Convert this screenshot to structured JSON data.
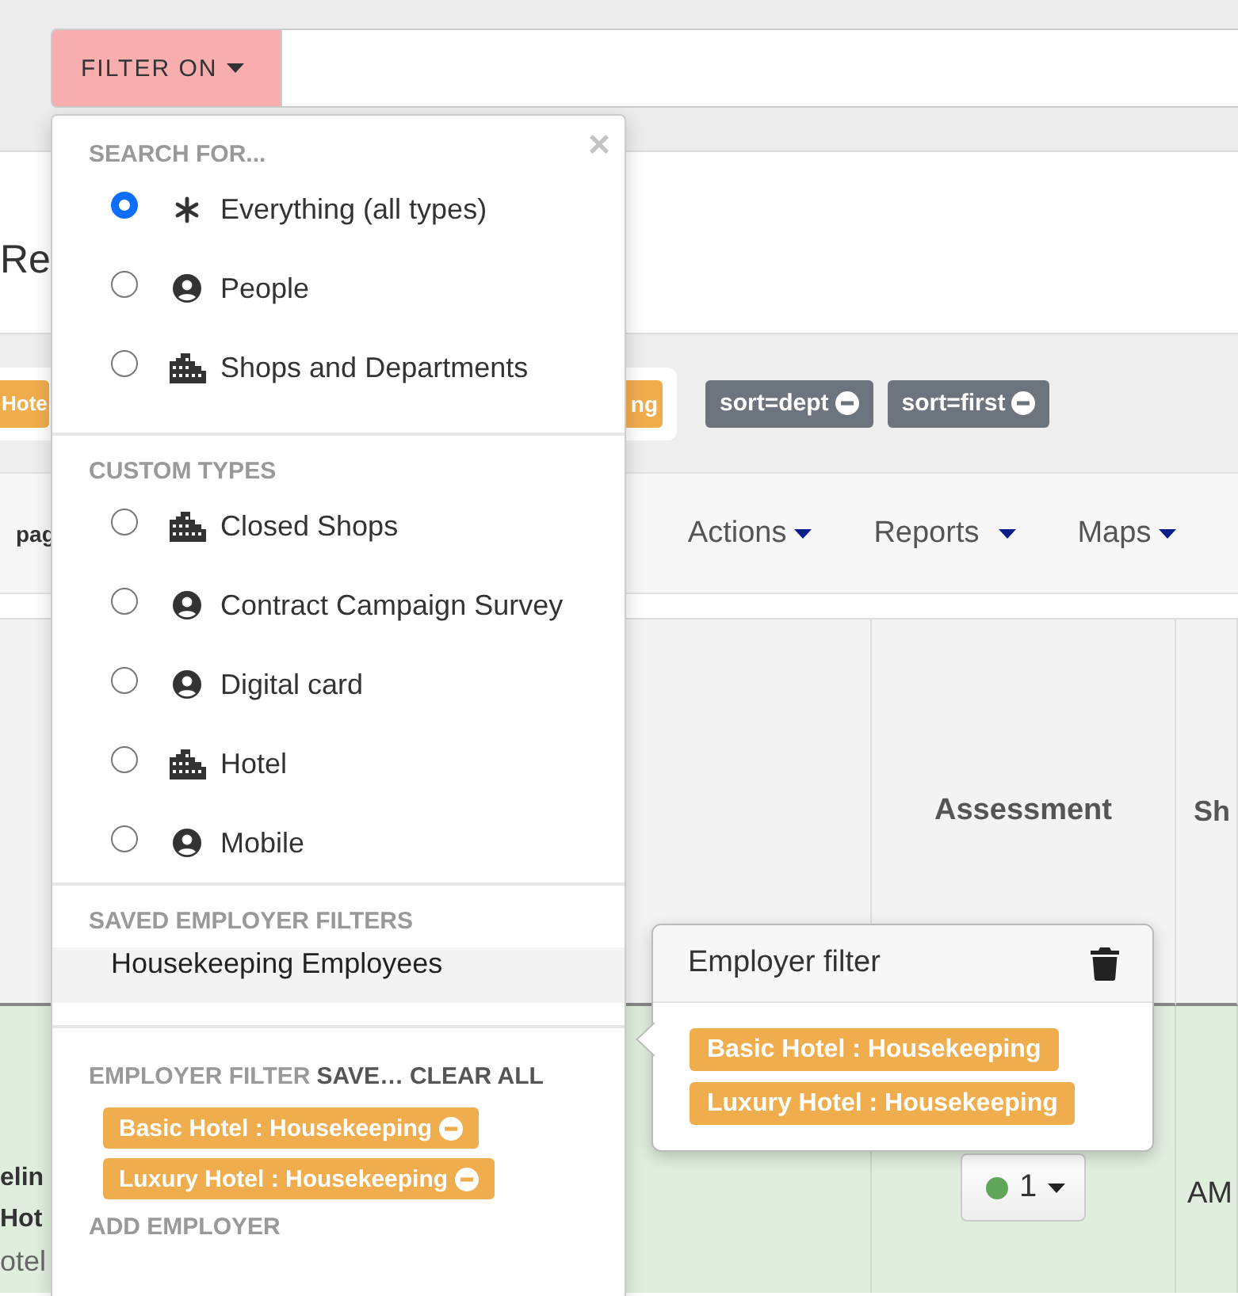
{
  "filter_bar": {
    "button": "FILTER ON"
  },
  "heading": "Re",
  "active_filters": [
    {
      "label": "Hote",
      "kind": "employer"
    },
    {
      "label": "ng",
      "kind": "employer"
    },
    {
      "label": "sort=dept",
      "kind": "sort"
    },
    {
      "label": "sort=first",
      "kind": "sort"
    }
  ],
  "toolbar": {
    "page_size": "pag",
    "menus": [
      "Actions",
      "Reports",
      "Maps"
    ]
  },
  "table": {
    "columns": [
      "Assessment",
      "Sh"
    ],
    "rows": [
      {
        "name_lines": [
          "elin",
          "Hot"
        ],
        "subtitle": "otel",
        "assessment": {
          "label": "1",
          "color": "#5fa55a"
        },
        "column_3": "AM"
      }
    ]
  },
  "dropdown": {
    "close": "×",
    "sections": [
      {
        "title": "SEARCH FOR...",
        "options": [
          {
            "label": "Everything (all types)",
            "kind": "all",
            "selected": true
          },
          {
            "label": "People",
            "kind": "person",
            "selected": false
          },
          {
            "label": "Shops and Departments",
            "kind": "building",
            "selected": false
          }
        ]
      },
      {
        "title": "CUSTOM TYPES",
        "options": [
          {
            "label": "Closed Shops",
            "kind": "building",
            "selected": false
          },
          {
            "label": "Contract Campaign Survey",
            "kind": "person",
            "selected": false
          },
          {
            "label": "Digital card",
            "kind": "person",
            "selected": false
          },
          {
            "label": "Hotel",
            "kind": "building",
            "selected": false
          },
          {
            "label": "Mobile",
            "kind": "person",
            "selected": false
          }
        ]
      }
    ],
    "saved": {
      "title": "SAVED EMPLOYER FILTERS",
      "items": [
        {
          "label": "Housekeeping Employees",
          "selected": true
        }
      ]
    },
    "employer_filter": {
      "title": "EMPLOYER FILTER",
      "actions": [
        "SAVE…",
        "CLEAR ALL"
      ],
      "tags": [
        "Basic Hotel : Housekeeping",
        "Luxury Hotel : Housekeeping"
      ]
    },
    "next_section": "ADD EMPLOYER"
  },
  "popover": {
    "title": "Employer filter",
    "tags": [
      "Basic Hotel : Housekeeping",
      "Luxury Hotel : Housekeeping"
    ]
  }
}
